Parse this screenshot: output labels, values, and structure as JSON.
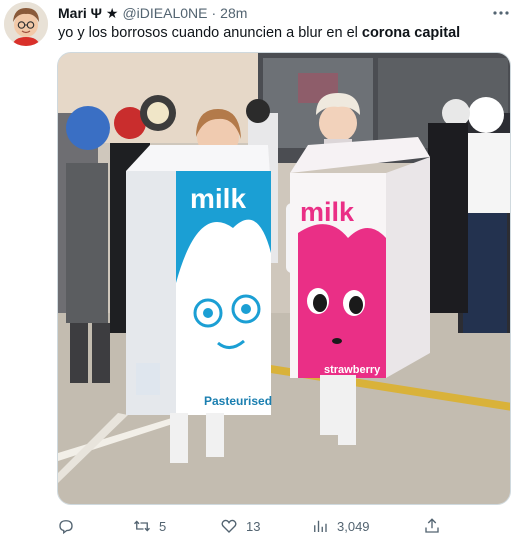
{
  "tweet": {
    "author": {
      "display_name": "Mari Ψ ★",
      "handle": "@iDIEAL0NE",
      "separator": "·",
      "time": "28m"
    },
    "text_before": "yo y los borrosos cuando anuncien a blur en el ",
    "text_bold": "corona capital",
    "media": {
      "carton_left": {
        "brand": "milk",
        "flavor": "Pasteurised",
        "color": "#1b9fd4"
      },
      "carton_right": {
        "brand": "milk",
        "flavor": "Strawberry",
        "color": "#ea2f86"
      }
    },
    "actions": {
      "reply_icon": "reply-icon",
      "retweet_icon": "retweet-icon",
      "retweet_count": "5",
      "like_icon": "heart-icon",
      "like_count": "13",
      "views_icon": "views-icon",
      "views_count": "3,049",
      "share_icon": "share-icon"
    }
  }
}
